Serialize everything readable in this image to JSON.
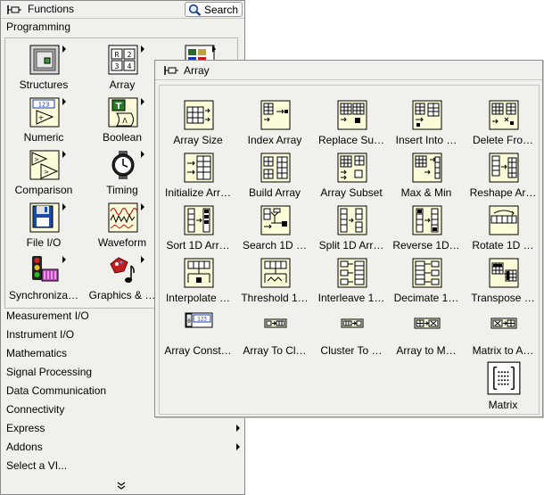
{
  "functions_palette": {
    "title": "Functions",
    "search_label": "Search",
    "programming_label": "Programming",
    "programming_items": [
      {
        "label": "Structures",
        "icon": "structures-icon"
      },
      {
        "label": "Array",
        "icon": "array-icon"
      },
      {
        "label": "",
        "icon": "cluster-icon"
      },
      {
        "label": "Numeric",
        "icon": "numeric-icon"
      },
      {
        "label": "Boolean",
        "icon": "boolean-icon"
      },
      {
        "label": "Comparison",
        "icon": "comparison-icon"
      },
      {
        "label": "Timing",
        "icon": "timing-icon"
      },
      {
        "label": "File I/O",
        "icon": "file-io-icon"
      },
      {
        "label": "Waveform",
        "icon": "waveform-icon"
      },
      {
        "label": "Synchroniza…",
        "icon": "synchronization-icon"
      },
      {
        "label": "Graphics & …",
        "icon": "graphics-sound-icon"
      }
    ],
    "categories": [
      {
        "label": "Measurement I/O"
      },
      {
        "label": "Instrument I/O"
      },
      {
        "label": "Mathematics"
      },
      {
        "label": "Signal Processing"
      },
      {
        "label": "Data Communication"
      },
      {
        "label": "Connectivity"
      },
      {
        "label": "Express"
      },
      {
        "label": "Addons"
      },
      {
        "label": "Select a VI..."
      }
    ]
  },
  "array_palette": {
    "title": "Array",
    "items": [
      {
        "label": "Array Size",
        "icon": "array-size-icon"
      },
      {
        "label": "Index Array",
        "icon": "index-array-icon"
      },
      {
        "label": "Replace Su…",
        "icon": "replace-subset-icon"
      },
      {
        "label": "Insert Into …",
        "icon": "insert-into-array-icon"
      },
      {
        "label": "Delete Fro…",
        "icon": "delete-from-array-icon"
      },
      {
        "label": "Initialize Arr…",
        "icon": "initialize-array-icon"
      },
      {
        "label": "Build Array",
        "icon": "build-array-icon"
      },
      {
        "label": "Array Subset",
        "icon": "array-subset-icon"
      },
      {
        "label": "Max & Min",
        "icon": "max-min-icon"
      },
      {
        "label": "Reshape Ar…",
        "icon": "reshape-array-icon"
      },
      {
        "label": "Sort 1D Arr…",
        "icon": "sort-1d-array-icon"
      },
      {
        "label": "Search 1D …",
        "icon": "search-1d-array-icon"
      },
      {
        "label": "Split 1D Arr…",
        "icon": "split-1d-array-icon"
      },
      {
        "label": "Reverse 1D…",
        "icon": "reverse-1d-array-icon"
      },
      {
        "label": "Rotate 1D …",
        "icon": "rotate-1d-array-icon"
      },
      {
        "label": "Interpolate …",
        "icon": "interpolate-array-icon"
      },
      {
        "label": "Threshold 1…",
        "icon": "threshold-1d-array-icon"
      },
      {
        "label": "Interleave 1…",
        "icon": "interleave-1d-arrays-icon"
      },
      {
        "label": "Decimate 1…",
        "icon": "decimate-1d-array-icon"
      },
      {
        "label": "Transpose …",
        "icon": "transpose-2d-array-icon"
      },
      {
        "label": "Array Const…",
        "icon": "array-constant-icon"
      },
      {
        "label": "Array To Cl…",
        "icon": "array-to-cluster-icon"
      },
      {
        "label": "Cluster To …",
        "icon": "cluster-to-array-icon"
      },
      {
        "label": "Array to M…",
        "icon": "array-to-matrix-icon"
      },
      {
        "label": "Matrix to A…",
        "icon": "matrix-to-array-icon"
      },
      {
        "label": "Matrix",
        "icon": "matrix-icon"
      }
    ]
  },
  "colors": {
    "palette_bg": "#f0f0ec",
    "icon_bg": "#fcfcd8",
    "icon_border": "#000000"
  }
}
